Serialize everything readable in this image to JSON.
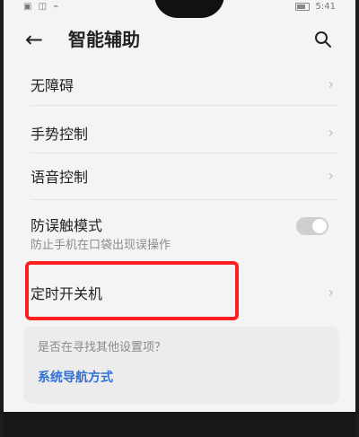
{
  "status": {
    "left_icons": "▣ ◫ ⌁",
    "time": "5:41"
  },
  "header": {
    "title": "智能辅助",
    "back_icon": "arrow-left",
    "search_icon": "search"
  },
  "items": [
    {
      "label": "无障碍"
    },
    {
      "label": "手势控制"
    },
    {
      "label": "语音控制"
    },
    {
      "label": "防误触模式",
      "subtitle": "防止手机在口袋出现误操作",
      "toggle": "off"
    },
    {
      "label": "定时开关机"
    }
  ],
  "suggestion": {
    "question": "是否在寻找其他设置项？",
    "link": "系统导航方式"
  },
  "colors": {
    "highlight": "#ff1f1f",
    "link": "#2f6fd6"
  }
}
